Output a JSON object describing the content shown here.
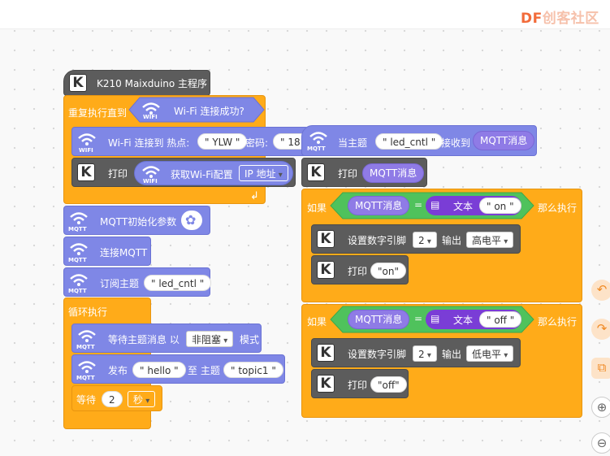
{
  "brand": {
    "logo_main": "DF",
    "logo_faded": "创客社区"
  },
  "main_program": {
    "hat_label": "K210 Maixduino 主程序",
    "repeat_until": "重复执行直到",
    "wifi_connected": "Wi-Fi 连接成功?",
    "wifi_connect_label": "Wi-Fi 连接到 热点:",
    "ssid": "\" YLW \"",
    "password_label": "密码:",
    "password": "\" 181",
    "print_label": "打印",
    "get_wifi_config": "获取Wi-Fi配置",
    "ip_option": "IP 地址",
    "mqtt_init": "MQTT初始化参数",
    "connect_mqtt": "连接MQTT",
    "subscribe": "订阅主题",
    "topic_led": "\" led_cntl \"",
    "forever": "循环执行",
    "wait_msg": "等待主题消息 以",
    "nonblocking": "非阻塞",
    "mode": "模式",
    "publish": "发布",
    "hello": "\" hello \"",
    "to_topic": "至 主题",
    "topic1": "\" topic1 \"",
    "wait": "等待",
    "wait_value": "2",
    "seconds": "秒"
  },
  "handler": {
    "when_topic": "当主题",
    "topic": "\" led_cntl \"",
    "received": "接收到",
    "mqtt_msg": "MQTT消息",
    "print_label": "打印",
    "if_label": "如果",
    "equals": "=",
    "text_label": "文本",
    "on_value": "\" on \"",
    "off_value": "\" off \"",
    "then_label": "那么执行",
    "set_pin": "设置数字引脚",
    "pin": "2",
    "output": "输出",
    "high": "高电平",
    "low": "低电平",
    "print_on": "\"on\"",
    "print_off": "\"off\""
  },
  "wifi_tag": "WIFI",
  "mqtt_tag": "MQTT",
  "k_tile": "K",
  "colors": {
    "control": "#ffab19",
    "network": "#7f87e6",
    "board": "#5c5c5c",
    "operator": "#4fc25c",
    "text": "#7a3dd6"
  }
}
